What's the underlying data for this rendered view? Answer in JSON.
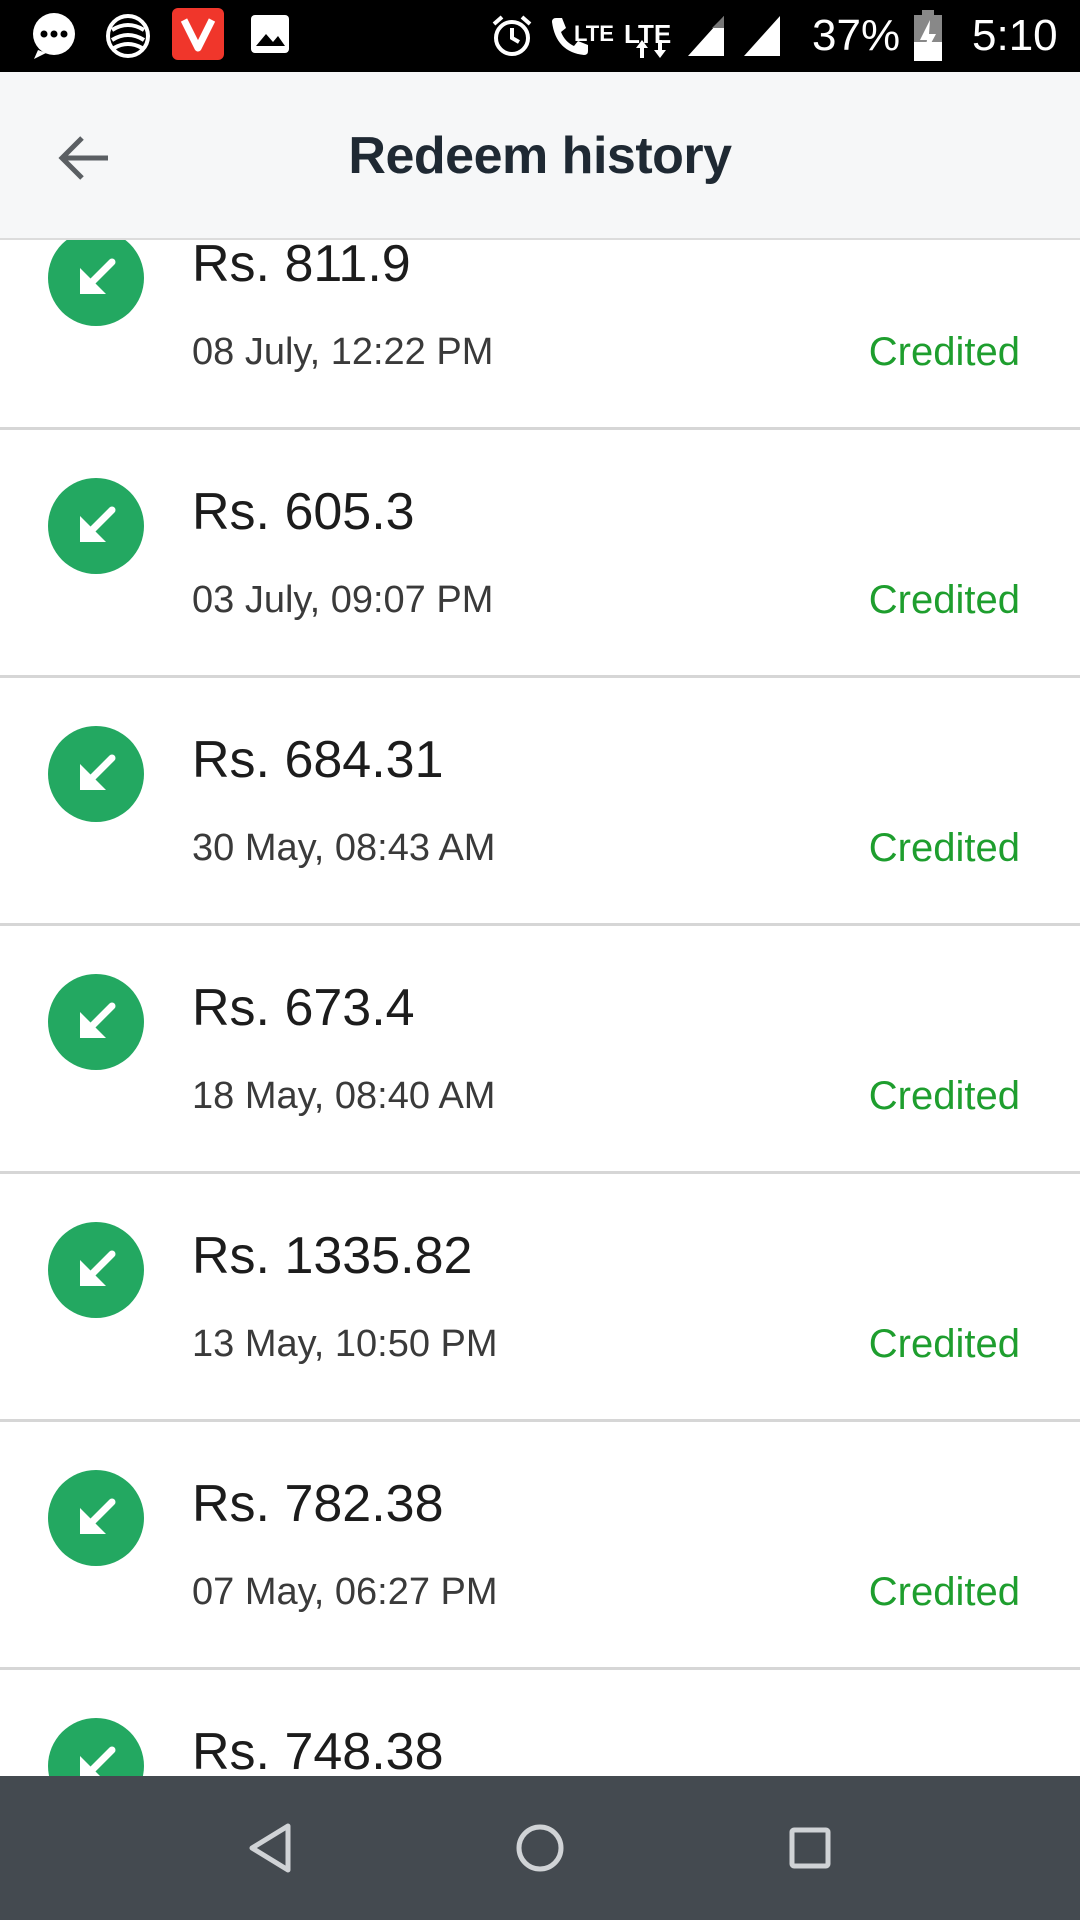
{
  "status_bar": {
    "battery_percent": "37%",
    "time": "5:10",
    "icons": [
      "message-icon",
      "app-icon",
      "vivo-app-icon",
      "gallery-icon",
      "alarm-icon",
      "volte-call-icon",
      "lte-data-icon",
      "signal-icon",
      "signal-icon-2",
      "battery-charging-icon"
    ],
    "lte_label": "LTE",
    "lte_label_2": "LTE"
  },
  "app_bar": {
    "title": "Redeem history",
    "back_icon": "arrow-left-icon"
  },
  "colors": {
    "accent_green": "#23a861",
    "status_green": "#1e9e2e",
    "nav_bar": "#444a50"
  },
  "transactions": [
    {
      "amount": "Rs. 811.9",
      "date": "08 July, 12:22 PM",
      "status": "Credited",
      "icon": "arrow-down-left-icon"
    },
    {
      "amount": "Rs. 605.3",
      "date": "03 July, 09:07 PM",
      "status": "Credited",
      "icon": "arrow-down-left-icon"
    },
    {
      "amount": "Rs. 684.31",
      "date": "30 May, 08:43 AM",
      "status": "Credited",
      "icon": "arrow-down-left-icon"
    },
    {
      "amount": "Rs. 673.4",
      "date": "18 May, 08:40 AM",
      "status": "Credited",
      "icon": "arrow-down-left-icon"
    },
    {
      "amount": "Rs. 1335.82",
      "date": "13 May, 10:50 PM",
      "status": "Credited",
      "icon": "arrow-down-left-icon"
    },
    {
      "amount": "Rs. 782.38",
      "date": "07 May, 06:27 PM",
      "status": "Credited",
      "icon": "arrow-down-left-icon"
    },
    {
      "amount": "Rs. 748.38",
      "date": "",
      "status": "",
      "icon": "arrow-down-left-icon"
    }
  ],
  "nav_bar": {
    "buttons": [
      "back-triangle-icon",
      "home-circle-icon",
      "recents-square-icon"
    ]
  }
}
